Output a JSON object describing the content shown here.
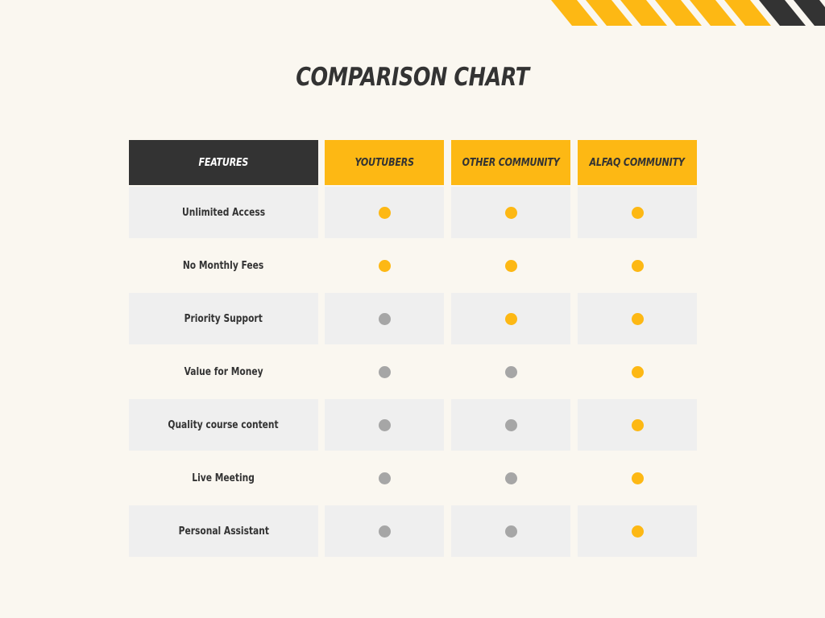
{
  "title": "COMPARISON CHART",
  "colors": {
    "background": "#faf7f0",
    "accent_yellow": "#fdb814",
    "dark": "#333333",
    "row_shade": "#efefef",
    "dot_yes": "#fdb814",
    "dot_no": "#a6a6a6"
  },
  "chart_data": {
    "type": "table",
    "title": "COMPARISON CHART",
    "header": {
      "feature_label": "FEATURES",
      "columns": [
        "YOUTUBERS",
        "OTHER COMMUNITY",
        "ALFAQ COMMUNITY"
      ]
    },
    "rows": [
      {
        "feature": "Unlimited Access",
        "values": [
          true,
          true,
          true
        ]
      },
      {
        "feature": "No Monthly Fees",
        "values": [
          true,
          true,
          true
        ]
      },
      {
        "feature": "Priority Support",
        "values": [
          false,
          true,
          true
        ]
      },
      {
        "feature": "Value for Money",
        "values": [
          false,
          false,
          true
        ]
      },
      {
        "feature": "Quality course content",
        "values": [
          false,
          false,
          true
        ]
      },
      {
        "feature": "Live Meeting",
        "values": [
          false,
          false,
          true
        ]
      },
      {
        "feature": "Personal Assistant",
        "values": [
          false,
          false,
          true
        ]
      }
    ]
  }
}
